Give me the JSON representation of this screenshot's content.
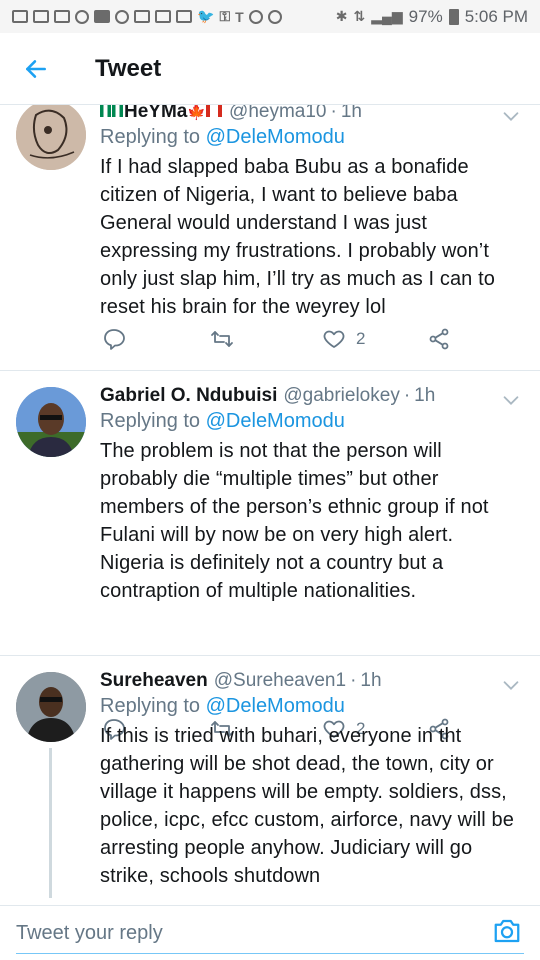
{
  "status_bar": {
    "battery": "97%",
    "time": "5:06 PM"
  },
  "header": {
    "title": "Tweet"
  },
  "tweets": [
    {
      "display_name": "HeYMa",
      "handle": "@heyma10",
      "time_ago": "1h",
      "replying_prefix": "Replying to",
      "replying_to": "@DeleMomodu",
      "text": "If I had slapped baba Bubu as a bonafide citizen of Nigeria, I want to believe baba General would understand I was just expressing my frustrations. I probably won’t only just slap him, I’ll try as much as I can to reset his brain for the weyrey lol",
      "likes": "2"
    },
    {
      "display_name": "Gabriel O. Ndubuisi",
      "handle": "@gabrielokey",
      "time_ago": "1h",
      "replying_prefix": "Replying to",
      "replying_to": "@DeleMomodu",
      "text": "The problem is not that the person will probably die “multiple times” but other members of the person’s ethnic group if not Fulani will by now be on very high alert. Nigeria is definitely not a country but a contraption of multiple nationalities.",
      "likes": "2"
    },
    {
      "display_name": "Sureheaven",
      "handle": "@Sureheaven1",
      "time_ago": "1h",
      "replying_prefix": "Replying to",
      "replying_to": "@DeleMomodu",
      "text": "If this is tried with buhari, everyone in tht gathering will be shot dead, the town, city or village it happens will be empty. soldiers, dss, police, icpc, efcc custom, airforce, navy will be arresting people anyhow. Judiciary will go strike, schools shutdown"
    }
  ],
  "reply_bar": {
    "placeholder": "Tweet your reply"
  },
  "colors": {
    "accent": "#1da1f2",
    "mention": "#1b95e0",
    "secondary_text": "#657786"
  }
}
